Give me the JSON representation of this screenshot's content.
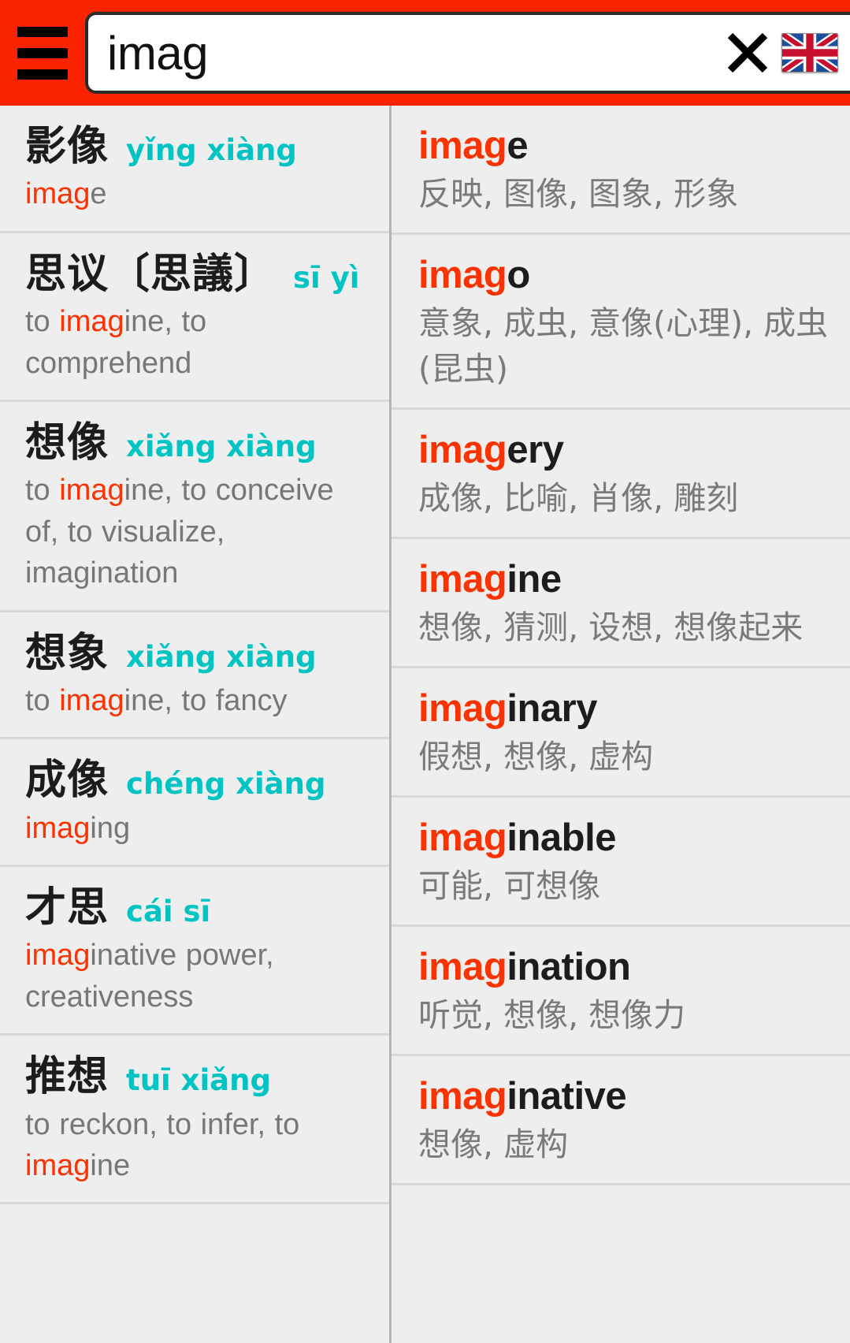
{
  "header": {
    "menu_icon": "hamburger-menu-icon",
    "search_value": "imag",
    "search_placeholder": "",
    "clear_icon": "close-x-icon",
    "language_flag": "uk-flag-icon",
    "grid_icon": "table-grid-icon",
    "bar_color": "#fc2400"
  },
  "colors": {
    "highlight": "#fc3200",
    "pinyin": "#00c4c4",
    "gloss": "#777777",
    "headword": "#1c1c1c",
    "row_bg": "#eeeeee",
    "divider": "#d8d8d8"
  },
  "query": "imag",
  "left_column": {
    "entries": [
      {
        "hanzi": "影像",
        "pinyin": "yǐng xiàng",
        "gloss_parts": [
          {
            "text": "imag",
            "hl": true
          },
          {
            "text": "e",
            "hl": false
          }
        ]
      },
      {
        "hanzi": "思议〔思議〕",
        "pinyin": "sī yì",
        "gloss_parts": [
          {
            "text": "to ",
            "hl": false
          },
          {
            "text": "imag",
            "hl": true
          },
          {
            "text": "ine, to comprehend",
            "hl": false
          }
        ]
      },
      {
        "hanzi": "想像",
        "pinyin": "xiǎng xiàng",
        "gloss_parts": [
          {
            "text": "to ",
            "hl": false
          },
          {
            "text": "imag",
            "hl": true
          },
          {
            "text": "ine, to conceive of, to visualize, imagination",
            "hl": false
          }
        ]
      },
      {
        "hanzi": "想象",
        "pinyin": "xiǎng xiàng",
        "gloss_parts": [
          {
            "text": "to ",
            "hl": false
          },
          {
            "text": "imag",
            "hl": true
          },
          {
            "text": "ine, to fancy",
            "hl": false
          }
        ]
      },
      {
        "hanzi": "成像",
        "pinyin": "chéng xiàng",
        "gloss_parts": [
          {
            "text": "imag",
            "hl": true
          },
          {
            "text": "ing",
            "hl": false
          }
        ]
      },
      {
        "hanzi": "才思",
        "pinyin": "cái sī",
        "gloss_parts": [
          {
            "text": "imag",
            "hl": true
          },
          {
            "text": "inative power, creativeness",
            "hl": false
          }
        ]
      },
      {
        "hanzi": "推想",
        "pinyin": "tuī xiǎng",
        "gloss_parts": [
          {
            "text": "to reckon, to infer, to ",
            "hl": false
          },
          {
            "text": "imag",
            "hl": true
          },
          {
            "text": "ine",
            "hl": false
          }
        ]
      }
    ]
  },
  "right_column": {
    "entries": [
      {
        "match": "imag",
        "rest": "e",
        "gloss": "反映, 图像, 图象, 形象"
      },
      {
        "match": "imag",
        "rest": "o",
        "gloss": "意象, 成虫, 意像(心理), 成虫(昆虫)"
      },
      {
        "match": "imag",
        "rest": "ery",
        "gloss": "成像, 比喻, 肖像, 雕刻"
      },
      {
        "match": "imag",
        "rest": "ine",
        "gloss": "想像, 猜测, 设想, 想像起来"
      },
      {
        "match": "imag",
        "rest": "inary",
        "gloss": "假想, 想像, 虚构"
      },
      {
        "match": "imag",
        "rest": "inable",
        "gloss": "可能, 可想像"
      },
      {
        "match": "imag",
        "rest": "ination",
        "gloss": "听觉, 想像, 想像力"
      },
      {
        "match": "imag",
        "rest": "inative",
        "gloss": "想像, 虚构"
      }
    ]
  }
}
